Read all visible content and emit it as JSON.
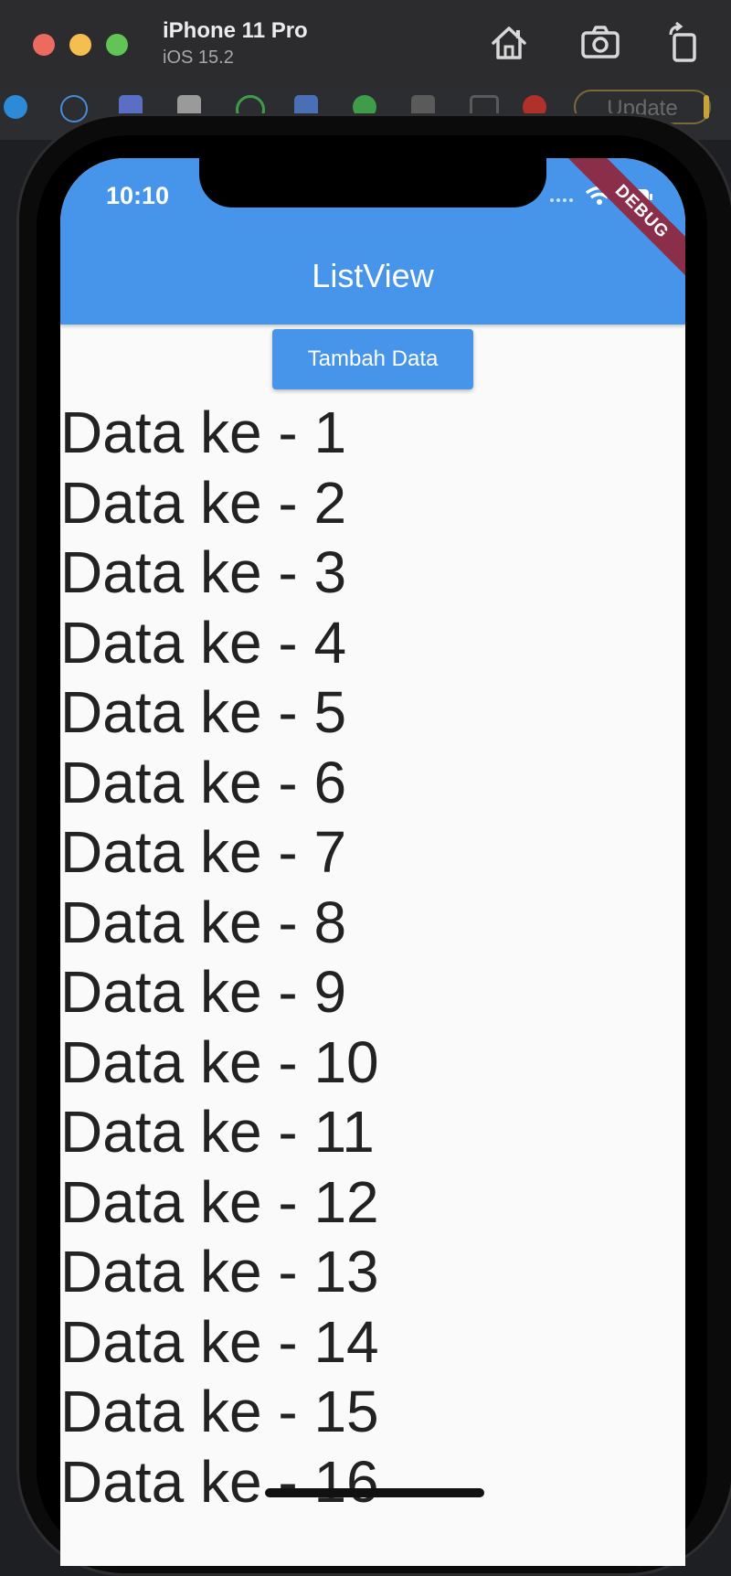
{
  "simulator": {
    "device_name": "iPhone 11 Pro",
    "os_version": "iOS 15.2"
  },
  "ide": {
    "update_label": "Update"
  },
  "status_bar": {
    "time": "10:10"
  },
  "app_bar": {
    "title": "ListView",
    "debug_banner": "DEBUG",
    "color": "#4695ea"
  },
  "button": {
    "label": "Tambah Data"
  },
  "list": {
    "items": [
      "Data ke - 1",
      "Data ke - 2",
      "Data ke - 3",
      "Data ke - 4",
      "Data ke - 5",
      "Data ke - 6",
      "Data ke - 7",
      "Data ke - 8",
      "Data ke - 9",
      "Data ke - 10",
      "Data ke - 11",
      "Data ke - 12",
      "Data ke - 13",
      "Data ke - 14",
      "Data ke - 15",
      "Data ke - 16"
    ]
  },
  "icons": {
    "home": "home-icon",
    "screenshot": "camera-icon",
    "rotate": "rotate-icon",
    "wifi": "wifi-icon",
    "battery": "battery-icon"
  }
}
